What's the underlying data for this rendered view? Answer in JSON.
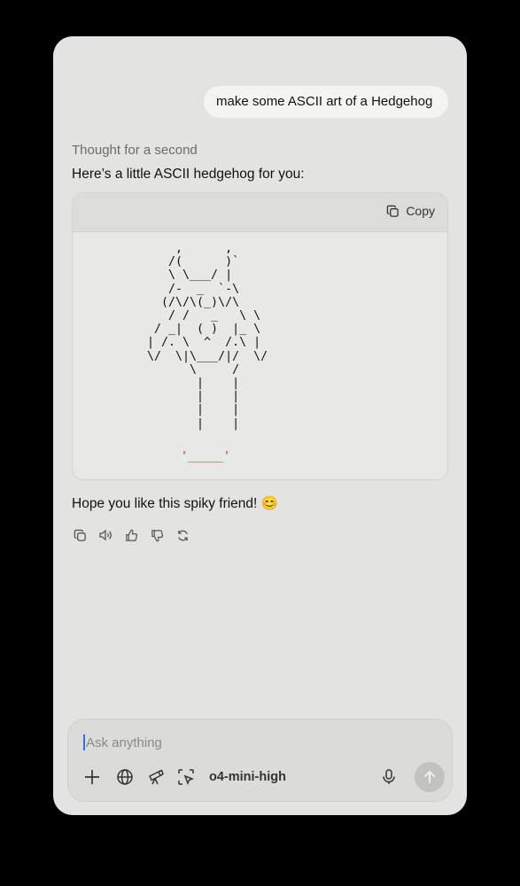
{
  "conversation": {
    "user_message": "make some ASCII art of a Hedgehog",
    "thought_label": "Thought for a second",
    "intro_text": "Here’s a little ASCII hedgehog for you:",
    "code_block": {
      "copy_label": "Copy",
      "ascii_art": "      ,      ,\n     /(      )`\n     \\ \\___/ |\n     /-  _  `-\\\n    (/\\/\\(_)\\/\\\n     / /   _   \\ \\\n   / _|  ( )  |_ \\\n  | /. \\  ^  /.\\ |\n  \\/  \\|\\___/|/  \\/\n        \\     /\n         |    |\n         |    |\n         |    |\n         |    |",
      "ascii_base": "'_____'"
    },
    "outro_text": "Hope you like this spiky friend! 😊",
    "message_actions": [
      "copy-icon",
      "speaker-icon",
      "thumbs-up-icon",
      "thumbs-down-icon",
      "regenerate-icon"
    ]
  },
  "composer": {
    "placeholder": "Ask anything",
    "model_label": "o4-mini-high",
    "tools": [
      "plus-icon",
      "globe-icon",
      "telescope-icon",
      "screen-select-icon"
    ]
  },
  "colors": {
    "page_background": "#000000",
    "window_background": "#e3e3e1",
    "code_background": "#e8e8e7",
    "ascii_accent": "#d81e1e",
    "caret": "#2f6fe8"
  }
}
